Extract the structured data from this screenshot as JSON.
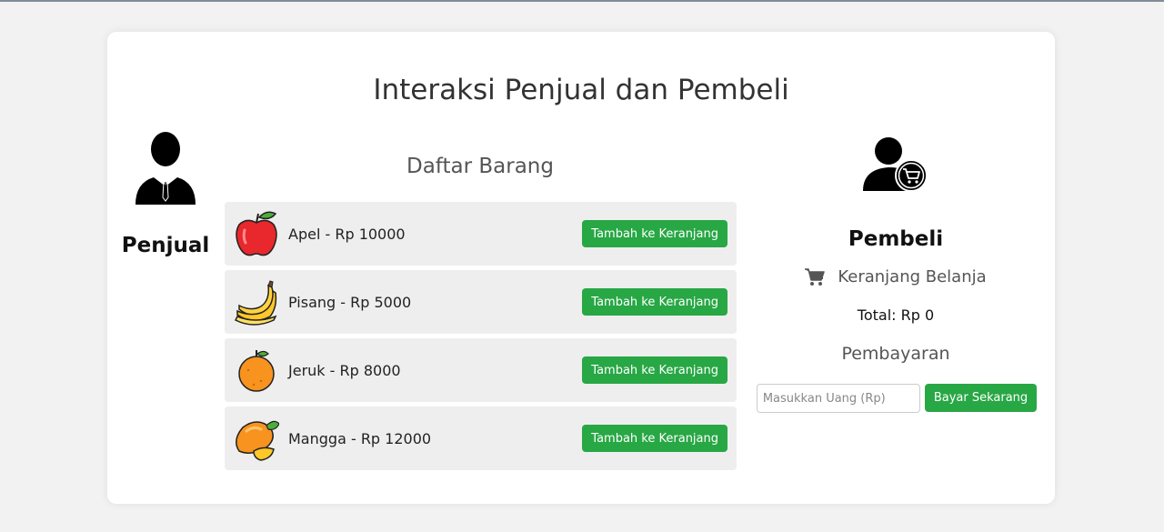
{
  "page": {
    "title": "Interaksi Penjual dan Pembeli"
  },
  "seller": {
    "label": "Penjual",
    "icon": "businessman-icon"
  },
  "products": {
    "title": "Daftar Barang",
    "items": [
      {
        "name": "Apel - Rp 10000",
        "icon": "apple-icon",
        "button": "Tambah ke Keranjang"
      },
      {
        "name": "Pisang - Rp 5000",
        "icon": "banana-icon",
        "button": "Tambah ke Keranjang"
      },
      {
        "name": "Jeruk - Rp 8000",
        "icon": "orange-icon",
        "button": "Tambah ke Keranjang"
      },
      {
        "name": "Mangga - Rp 12000",
        "icon": "mango-icon",
        "button": "Tambah ke Keranjang"
      }
    ]
  },
  "buyer": {
    "label": "Pembeli",
    "icon": "user-cart-icon",
    "cart_title": "Keranjang Belanja",
    "total": "Total: Rp 0",
    "payment_title": "Pembayaran",
    "payment_placeholder": "Masukkan Uang (Rp)",
    "pay_button": "Bayar Sekarang"
  },
  "colors": {
    "accent": "#28a745",
    "background": "#f2f2f2",
    "card": "#ffffff",
    "item_bg": "#eeeeee"
  }
}
